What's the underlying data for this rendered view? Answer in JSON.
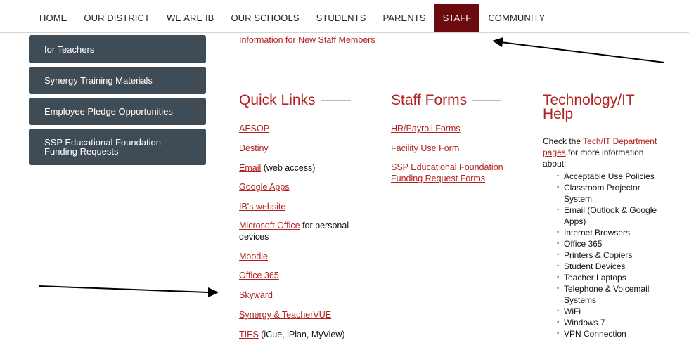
{
  "nav": {
    "items": [
      {
        "label": "HOME"
      },
      {
        "label": "OUR DISTRICT"
      },
      {
        "label": "WE ARE IB"
      },
      {
        "label": "OUR SCHOOLS"
      },
      {
        "label": "STUDENTS"
      },
      {
        "label": "PARENTS"
      },
      {
        "label": "STAFF",
        "active": true
      },
      {
        "label": "COMMUNITY"
      }
    ],
    "active_color": "#6b0a0f"
  },
  "sidebar": {
    "items": [
      {
        "label": "for Teachers"
      },
      {
        "label": "Synergy Training Materials"
      },
      {
        "label": "Employee Pledge Opportunities"
      },
      {
        "label": "SSP Educational Foundation Funding Requests"
      }
    ],
    "color": "#3f4b55"
  },
  "top_link": "Information for New Staff Members",
  "quick_links": {
    "title": "Quick Links",
    "items": [
      {
        "link": "AESOP",
        "suffix": ""
      },
      {
        "link": "Destiny",
        "suffix": ""
      },
      {
        "link": "Email",
        "suffix": " (web access)"
      },
      {
        "link": "Google Apps",
        "suffix": ""
      },
      {
        "link": "IB's website",
        "suffix": ""
      },
      {
        "link": "Microsoft Office",
        "suffix": " for personal",
        "suffix2": "devices"
      },
      {
        "link": "Moodle",
        "suffix": ""
      },
      {
        "link": "Office 365",
        "suffix": ""
      },
      {
        "link": "Skyward",
        "suffix": ""
      },
      {
        "link": "Synergy & TeacherVUE",
        "suffix": ""
      },
      {
        "link": "TIES",
        "suffix": " (iCue, iPlan, MyView)"
      }
    ]
  },
  "staff_forms": {
    "title": "Staff Forms",
    "items": [
      {
        "label": "HR/Payroll Forms"
      },
      {
        "label": "Facility Use Form"
      },
      {
        "label": "SSP Educational Foundation Funding Request Forms"
      }
    ]
  },
  "tech": {
    "title_line1": "Technology/IT",
    "title_line2": "Help",
    "intro_pre": "Check the ",
    "intro_link": "Tech/IT Department pages",
    "intro_post": " for more information about:",
    "items": [
      "Acceptable Use Policies",
      "Classroom Projector System",
      "Email (Outlook & Google Apps)",
      "Internet Browsers",
      "Office 365",
      "Printers & Copiers",
      "Student Devices",
      "Teacher Laptops",
      "Telephone & Voicemail Systems",
      "WiFi",
      "Windows 7",
      "VPN Connection"
    ]
  },
  "accent_color": "#b32121"
}
